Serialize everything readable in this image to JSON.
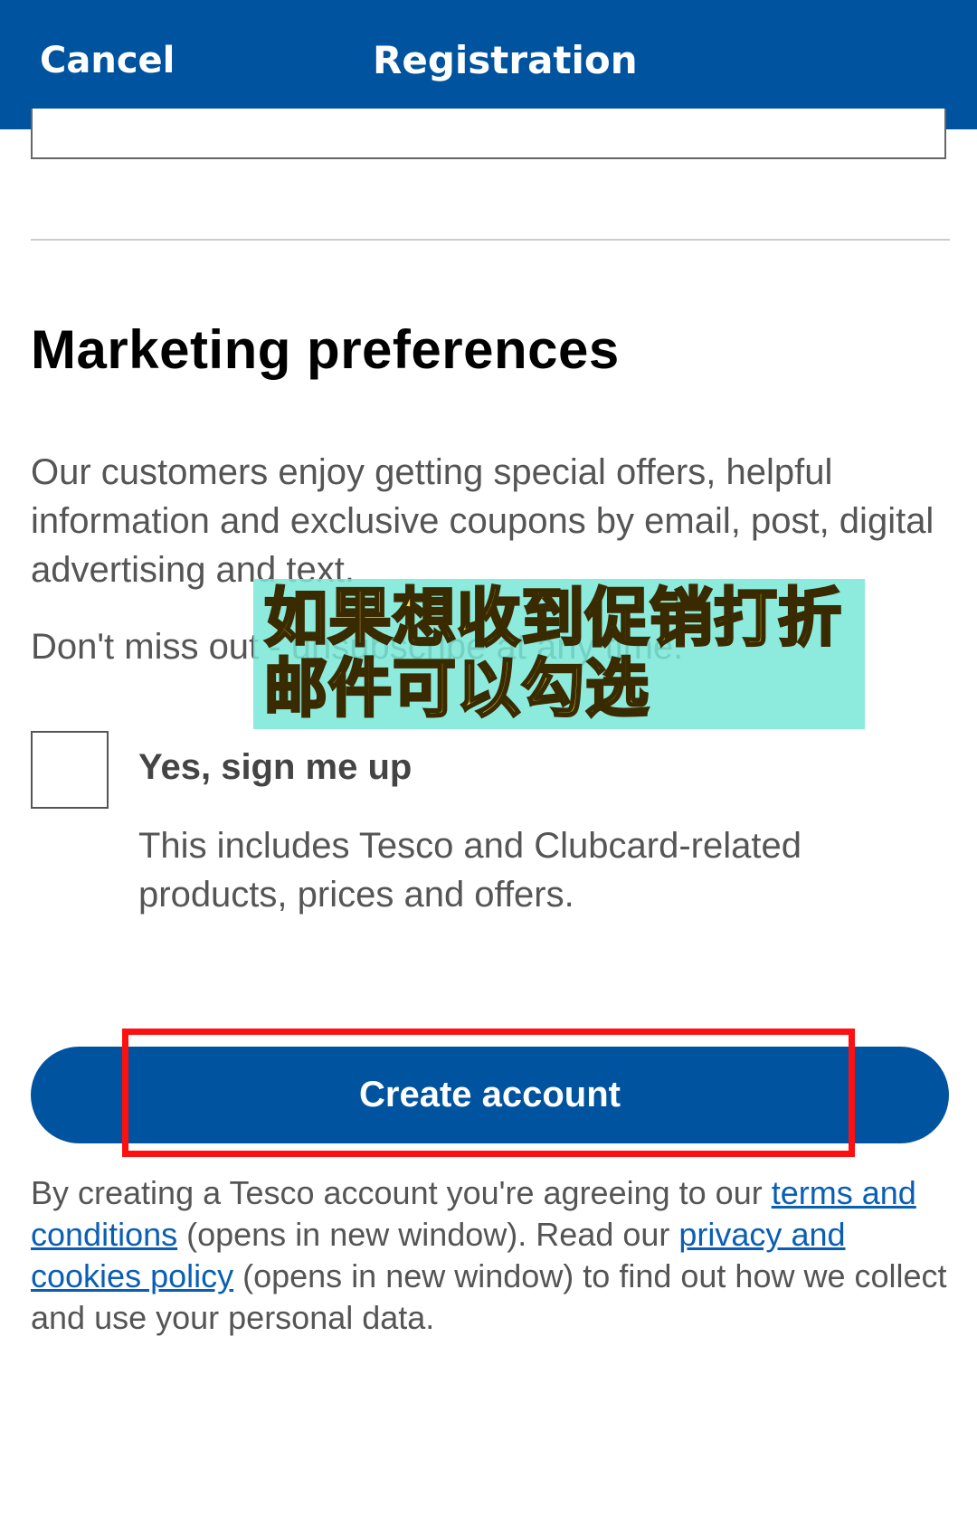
{
  "header": {
    "cancel_label": "Cancel",
    "title": "Registration"
  },
  "marketing": {
    "title": "Marketing preferences",
    "intro": "Our customers enjoy getting special offers, helpful information and exclusive coupons by email, post, digital advertising and text.",
    "unsubscribe_text": "Don't miss out - unsubscribe at any time.",
    "checkbox_checked": false,
    "checkbox_label": "Yes, sign me up",
    "checkbox_description": "This includes Tesco and Clubcard-related products, prices and offers."
  },
  "overlay": {
    "line1": "如果想收到促销打折",
    "line2": "邮件可以勾选",
    "background_color": "#78e8d6",
    "text_color": "#ffe033"
  },
  "create_button": {
    "label": "Create account"
  },
  "legal": {
    "prefix": "By creating a Tesco account you're agreeing to our ",
    "terms_link": "terms and conditions",
    "middle": " (opens in new window). Read our ",
    "privacy_link": "privacy and cookies policy",
    "suffix": " (opens in new window) to find out how we collect and use your personal data."
  },
  "colors": {
    "brand_blue": "#00539f",
    "highlight_red": "#ff1010",
    "link_blue": "#0a5fb4"
  }
}
